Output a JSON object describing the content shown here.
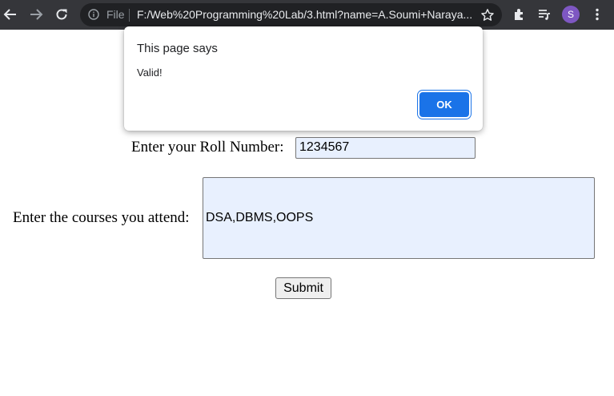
{
  "browser": {
    "url_scheme_label": "File",
    "url": "F:/Web%20Programming%20Lab/3.html?name=A.Soumi+Naraya...",
    "profile_initial": "S",
    "accent_color": "#1a73e8",
    "avatar_color": "#7e57c2"
  },
  "form": {
    "roll_label": "Enter your Roll Number:",
    "roll_value": "1234567",
    "courses_label": "Enter the courses you attend:",
    "courses_value": "DSA,DBMS,OOPS",
    "submit_label": "Submit",
    "autofill_color": "#e8f0fe"
  },
  "alert": {
    "title": "This page says",
    "message": "Valid!",
    "ok_label": "OK"
  }
}
